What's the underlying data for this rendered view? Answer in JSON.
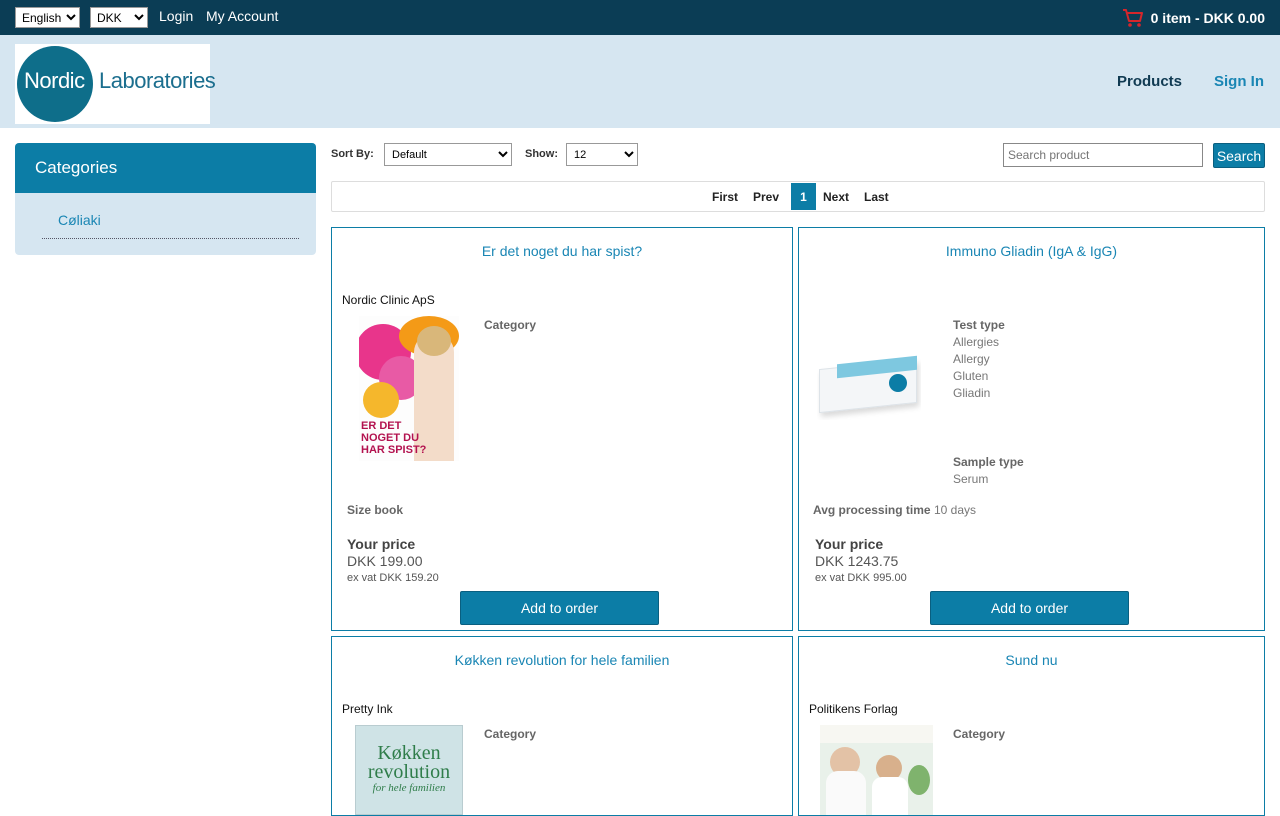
{
  "topbar": {
    "language": "English",
    "currency": "DKK",
    "login": "Login",
    "account": "My Account",
    "cart": "0 item - DKK 0.00"
  },
  "header": {
    "logo_word1": "Nordic",
    "logo_word2": "Laboratories",
    "nav_products": "Products",
    "nav_signin": "Sign In"
  },
  "sidebar": {
    "title": "Categories",
    "items": [
      {
        "label": "Cøliaki"
      }
    ]
  },
  "toolbar": {
    "sort_label": "Sort By:",
    "sort_value": "Default",
    "show_label": "Show:",
    "show_value": "12",
    "search_placeholder": "Search product",
    "search_button": "Search"
  },
  "pager": {
    "first": "First",
    "prev": "Prev",
    "current": "1",
    "next": "Next",
    "last": "Last"
  },
  "products": [
    {
      "title": "Er det noget du har spist?",
      "maker": "Nordic Clinic ApS",
      "category_label": "Category",
      "size_label": "Size book",
      "price_label": "Your price",
      "price": "DKK 199.00",
      "exvat": "ex vat DKK 159.20",
      "button": "Add to order",
      "cover_text": "ER DET NOGET DU HAR SPIST?"
    },
    {
      "title": "Immuno Gliadin (IgA & IgG)",
      "test_type_label": "Test type",
      "test_types": [
        "Allergies",
        "Allergy",
        "Gluten",
        "Gliadin"
      ],
      "sample_type_label": "Sample type",
      "sample_type": "Serum",
      "processing_label": "Avg processing time",
      "processing_value": "10 days",
      "price_label": "Your price",
      "price": "DKK 1243.75",
      "exvat": "ex vat DKK 995.00",
      "button": "Add to order"
    },
    {
      "title": "Køkken revolution for hele familien",
      "maker": "Pretty Ink",
      "category_label": "Category",
      "cover_text_1": "Køkken",
      "cover_text_2": "revolution",
      "cover_text_3": "for hele familien"
    },
    {
      "title": "Sund nu",
      "maker": "Politikens Forlag",
      "category_label": "Category"
    }
  ],
  "colors": {
    "topbar": "#0b3d55",
    "header": "#d6e6f1",
    "accent": "#0c7da6",
    "link": "#1a86b4"
  }
}
